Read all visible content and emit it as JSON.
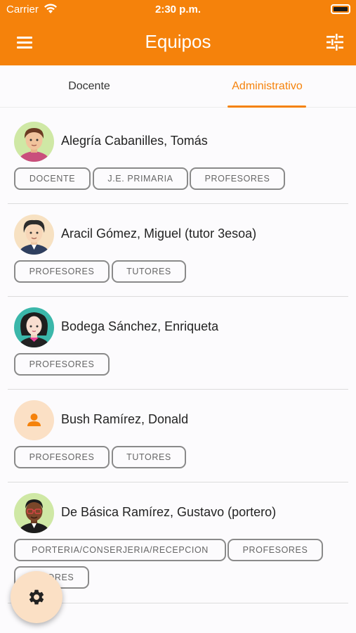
{
  "status_bar": {
    "carrier": "Carrier",
    "time": "2:30 p.m."
  },
  "app_bar": {
    "title": "Equipos",
    "menu_icon": "hamburger-menu-icon",
    "filter_icon": "tune-sliders-icon"
  },
  "tabs": [
    {
      "label": "Docente",
      "selected": false
    },
    {
      "label": "Administrativo",
      "selected": true
    }
  ],
  "people": [
    {
      "name": "Alegría Cabanilles, Tomás",
      "avatar": "avatar-young-man",
      "tags": [
        "DOCENTE",
        "J.E. PRIMARIA",
        "PROFESORES"
      ]
    },
    {
      "name": "Aracil Gómez, Miguel (tutor 3esoa)",
      "avatar": "avatar-man-dark-hair",
      "tags": [
        "PROFESORES",
        "TUTORES"
      ]
    },
    {
      "name": "Bodega Sánchez, Enriqueta",
      "avatar": "avatar-woman-black-hair",
      "tags": [
        "PROFESORES"
      ]
    },
    {
      "name": "Bush Ramírez, Donald",
      "avatar": "person-placeholder-icon",
      "tags": [
        "PROFESORES",
        "TUTORES"
      ]
    },
    {
      "name": "De Básica Ramírez, Gustavo (portero)",
      "avatar": "avatar-man-glasses",
      "tags": [
        "PORTERIA/CONSERJERIA/RECEPCION",
        "PROFESORES",
        "TUTORES"
      ]
    }
  ],
  "fab": {
    "icon": "gear-icon"
  },
  "colors": {
    "accent": "#f5820b",
    "fab_bg": "#fbe0c5",
    "tag_border": "#8a8a8a"
  }
}
